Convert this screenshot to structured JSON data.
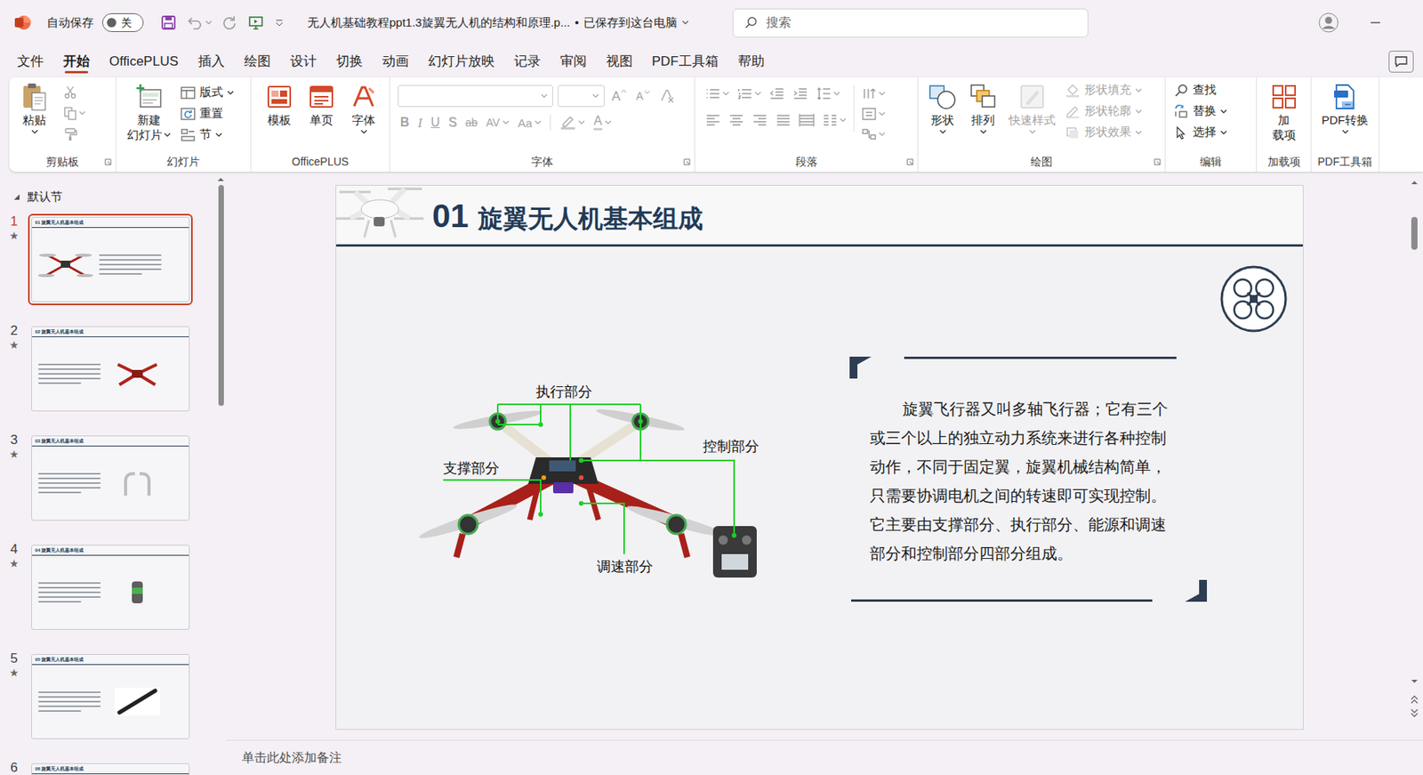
{
  "window": {
    "autosave_label": "自动保存",
    "autosave_toggle": {
      "text": "关",
      "on": false
    },
    "title": "无人机基础教程ppt1.3旋翼无人机的结构和原理.p...",
    "separator": "•",
    "save_status": "已保存到这台电脑"
  },
  "search": {
    "placeholder": "搜索"
  },
  "menu_tabs": [
    {
      "label": "文件",
      "selected": false
    },
    {
      "label": "开始",
      "selected": true
    },
    {
      "label": "OfficePLUS",
      "selected": false
    },
    {
      "label": "插入",
      "selected": false
    },
    {
      "label": "绘图",
      "selected": false
    },
    {
      "label": "设计",
      "selected": false
    },
    {
      "label": "切换",
      "selected": false
    },
    {
      "label": "动画",
      "selected": false
    },
    {
      "label": "幻灯片放映",
      "selected": false
    },
    {
      "label": "记录",
      "selected": false
    },
    {
      "label": "审阅",
      "selected": false
    },
    {
      "label": "视图",
      "selected": false
    },
    {
      "label": "PDF工具箱",
      "selected": false
    },
    {
      "label": "帮助",
      "selected": false
    }
  ],
  "ribbon": {
    "groups": [
      {
        "label": "剪贴板",
        "launcher": true,
        "items": [
          {
            "kind": "large",
            "label": "粘贴",
            "menu": true,
            "disabled": false
          },
          {
            "kind": "icon",
            "disabled": true
          },
          {
            "kind": "icon",
            "menu": true,
            "disabled": true
          },
          {
            "kind": "icon",
            "disabled": true
          }
        ]
      },
      {
        "label": "幻灯片",
        "items": [
          {
            "kind": "large",
            "label_lines": [
              "新建",
              "幻灯片"
            ],
            "menu": true,
            "disabled": false
          },
          {
            "kind": "small",
            "label": "版式",
            "menu": true,
            "disabled": false
          },
          {
            "kind": "small",
            "label": "重置",
            "disabled": false
          },
          {
            "kind": "small",
            "label": "节",
            "menu": true,
            "disabled": false
          }
        ]
      },
      {
        "label": "OfficePLUS",
        "items": [
          {
            "kind": "large",
            "label": "模板",
            "disabled": false
          },
          {
            "kind": "large",
            "label": "单页",
            "disabled": false
          },
          {
            "kind": "large",
            "label": "字体",
            "menu": true,
            "disabled": false
          }
        ]
      },
      {
        "label": "字体",
        "launcher": true,
        "items": [
          {
            "kind": "field",
            "menu": true,
            "disabled": true
          },
          {
            "kind": "field",
            "menu": true,
            "disabled": true
          },
          {
            "kind": "glyph",
            "style": "grow",
            "text": "A",
            "disabled": true
          },
          {
            "kind": "glyph",
            "style": "shrink",
            "text": "A",
            "disabled": true
          },
          {
            "kind": "icon",
            "disabled": true
          },
          {
            "kind": "glyph",
            "style": "bold",
            "text": "B",
            "disabled": true
          },
          {
            "kind": "glyph",
            "style": "italic",
            "text": "I",
            "disabled": true
          },
          {
            "kind": "glyph",
            "style": "underline",
            "text": "U",
            "disabled": true
          },
          {
            "kind": "glyph",
            "style": "shadow",
            "text": "S",
            "disabled": true
          },
          {
            "kind": "glyph",
            "style": "strike",
            "text": "ab",
            "disabled": true
          },
          {
            "kind": "glyph",
            "style": "spacing",
            "text": "AV",
            "menu": true,
            "disabled": true
          },
          {
            "kind": "glyph",
            "style": "case",
            "text": "Aa",
            "menu": true,
            "disabled": true
          },
          {
            "kind": "icon",
            "menu": true,
            "disabled": true
          },
          {
            "kind": "glyph",
            "style": "color",
            "text": "A",
            "menu": true,
            "disabled": true
          }
        ]
      },
      {
        "label": "段落",
        "launcher": true,
        "items": [
          {
            "kind": "icon",
            "menu": true,
            "disabled": true
          },
          {
            "kind": "icon",
            "menu": true,
            "disabled": true
          },
          {
            "kind": "icon",
            "disabled": true
          },
          {
            "kind": "icon",
            "disabled": true
          },
          {
            "kind": "icon",
            "menu": true,
            "disabled": true
          },
          {
            "kind": "icon",
            "disabled": true
          },
          {
            "kind": "icon",
            "disabled": true
          },
          {
            "kind": "icon",
            "disabled": true
          },
          {
            "kind": "icon",
            "disabled": true
          },
          {
            "kind": "icon",
            "disabled": true
          },
          {
            "kind": "icon",
            "menu": true,
            "disabled": true
          },
          {
            "kind": "icon",
            "menu": true,
            "disabled": true
          },
          {
            "kind": "icon",
            "menu": true,
            "disabled": true
          },
          {
            "kind": "icon",
            "menu": true,
            "disabled": true
          }
        ]
      },
      {
        "label": "绘图",
        "launcher": true,
        "items": [
          {
            "kind": "large",
            "label": "形状",
            "menu": true,
            "disabled": false
          },
          {
            "kind": "large",
            "label": "排列",
            "menu": true,
            "disabled": false
          },
          {
            "kind": "large",
            "label": "快速样式",
            "menu": true,
            "disabled": true
          },
          {
            "kind": "small",
            "label": "形状填充",
            "menu": true,
            "disabled": true
          },
          {
            "kind": "small",
            "label": "形状轮廓",
            "menu": true,
            "disabled": true
          },
          {
            "kind": "small",
            "label": "形状效果",
            "menu": true,
            "disabled": true
          }
        ]
      },
      {
        "label": "编辑",
        "items": [
          {
            "kind": "small",
            "label": "查找",
            "disabled": false
          },
          {
            "kind": "small",
            "label": "替换",
            "menu": true,
            "disabled": false
          },
          {
            "kind": "small",
            "label": "选择",
            "menu": true,
            "disabled": false
          }
        ]
      },
      {
        "label": "加载项",
        "items": [
          {
            "kind": "large",
            "label_lines": [
              "加",
              "载项"
            ],
            "disabled": false
          }
        ]
      },
      {
        "label": "PDF工具箱",
        "items": [
          {
            "kind": "large",
            "label": "PDF转换",
            "menu": true,
            "disabled": false
          }
        ]
      }
    ]
  },
  "slides_panel": {
    "section": {
      "label": "默认节",
      "expanded": true
    },
    "slides": [
      {
        "number": "1",
        "star": "★",
        "title": "01 旋翼无人机基本组成",
        "selected": true
      },
      {
        "number": "2",
        "star": "★",
        "title": "02 旋翼无人机基本组成",
        "selected": false
      },
      {
        "number": "3",
        "star": "★",
        "title": "03 旋翼无人机基本组成",
        "selected": false
      },
      {
        "number": "4",
        "star": "★",
        "title": "04 旋翼无人机基本组成",
        "selected": false
      },
      {
        "number": "5",
        "star": "★",
        "title": "05 旋翼无人机基本组成",
        "selected": false
      },
      {
        "number": "6",
        "star": "★",
        "title": "06 旋翼无人机基本组成",
        "selected": false
      }
    ]
  },
  "slide": {
    "title_number": "01",
    "title": "旋翼无人机基本组成",
    "diagram_labels": [
      "执行部分",
      "支撑部分",
      "控制部分",
      "调速部分"
    ],
    "paragraph_lines": [
      "旋翼飞行器又叫多轴飞行器；它有三个",
      "或三个以上的独立动力系统来进行各种控制",
      "动作，不同于固定翼，旋翼机械结构简单，",
      "只需要协调电机之间的转速即可实现控制。",
      "它主要由支撑部分、执行部分、能源和调速",
      "部分和控制部分四部分组成。"
    ]
  },
  "notes": {
    "placeholder": "单击此处添加备注"
  }
}
